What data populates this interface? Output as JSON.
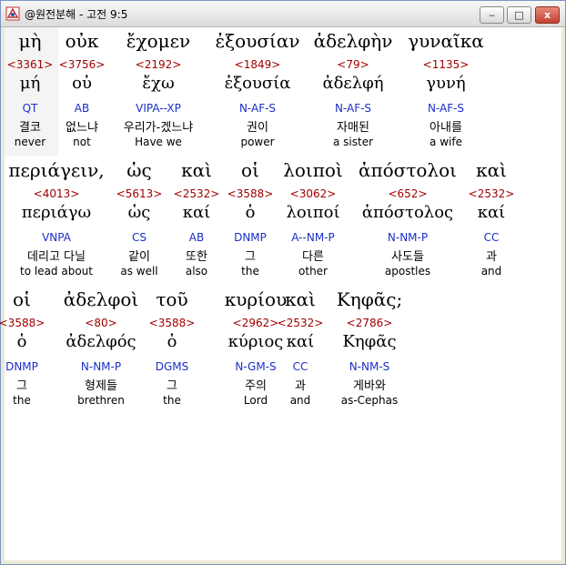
{
  "window": {
    "title": "@원전분해 - 고전 9:5",
    "buttons": {
      "minimize": "‒",
      "maximize": "□",
      "close": "x"
    }
  },
  "rows": [
    [
      {
        "greek": "μὴ",
        "strong": "<3361>",
        "lemma": "μή",
        "parse": "QT",
        "korean": "결코",
        "english": "never"
      },
      {
        "greek": "οὐκ",
        "strong": "<3756>",
        "lemma": "οὐ",
        "parse": "AB",
        "korean": "없느냐",
        "english": "not"
      },
      {
        "greek": "ἔχομεν",
        "strong": "<2192>",
        "lemma": "ἔχω",
        "parse": "VIPA--XP",
        "korean": "우리가-겠느냐",
        "english": "Have we"
      },
      {
        "greek": "ἐξουσίαν",
        "strong": "<1849>",
        "lemma": "ἐξουσία",
        "parse": "N-AF-S",
        "korean": "권이",
        "english": "power"
      },
      {
        "greek": "ἀδελφὴν",
        "strong": "<79>",
        "lemma": "ἀδελφή",
        "parse": "N-AF-S",
        "korean": "자매된",
        "english": "a sister"
      },
      {
        "greek": "γυναῖκα",
        "strong": "<1135>",
        "lemma": "γυνή",
        "parse": "N-AF-S",
        "korean": "아내를",
        "english": "a wife"
      }
    ],
    [
      {
        "greek": "περιάγειν,",
        "strong": "<4013>",
        "lemma": "περιάγω",
        "parse": "VNPA",
        "korean": "데리고 다닐",
        "english": "to lead about"
      },
      {
        "greek": "ὡς",
        "strong": "<5613>",
        "lemma": "ὡς",
        "parse": "CS",
        "korean": "같이",
        "english": "as well"
      },
      {
        "greek": "καὶ",
        "strong": "<2532>",
        "lemma": "καί",
        "parse": "AB",
        "korean": "또한",
        "english": "also"
      },
      {
        "greek": "οἱ",
        "strong": "<3588>",
        "lemma": "ὁ",
        "parse": "DNMP",
        "korean": "그",
        "english": "the"
      },
      {
        "greek": "λοιποὶ",
        "strong": "<3062>",
        "lemma": "λοιποί",
        "parse": "A--NM-P",
        "korean": "다른",
        "english": "other"
      },
      {
        "greek": "ἀπόστολοι",
        "strong": "<652>",
        "lemma": "ἀπόστολος",
        "parse": "N-NM-P",
        "korean": "사도들",
        "english": "apostles"
      },
      {
        "greek": "καὶ",
        "strong": "<2532>",
        "lemma": "καί",
        "parse": "CC",
        "korean": "과",
        "english": "and"
      }
    ],
    [
      {
        "greek": "οἱ",
        "strong": "<3588>",
        "lemma": "ὁ",
        "parse": "DNMP",
        "korean": "그",
        "english": "the"
      },
      {
        "greek": "ἀδελφοὶ",
        "strong": "<80>",
        "lemma": "ἀδελφός",
        "parse": "N-NM-P",
        "korean": "형제들",
        "english": "brethren"
      },
      {
        "greek": "τοῦ",
        "strong": "<3588>",
        "lemma": "ὁ",
        "parse": "DGMS",
        "korean": "그",
        "english": "the"
      },
      {
        "greek": "κυρίου",
        "strong": "<2962>",
        "lemma": "κύριος",
        "parse": "N-GM-S",
        "korean": "주의",
        "english": "Lord"
      },
      {
        "greek": "καὶ",
        "strong": "<2532>",
        "lemma": "καί",
        "parse": "CC",
        "korean": "과",
        "english": "and"
      },
      {
        "greek": "Κηφᾶς;",
        "strong": "<2786>",
        "lemma": "Κηφᾶς",
        "parse": "N-NM-S",
        "korean": "게바와",
        "english": "as-Cephas"
      }
    ]
  ],
  "colors": {
    "strong": "#a00000",
    "parse": "#1a2fc8"
  }
}
